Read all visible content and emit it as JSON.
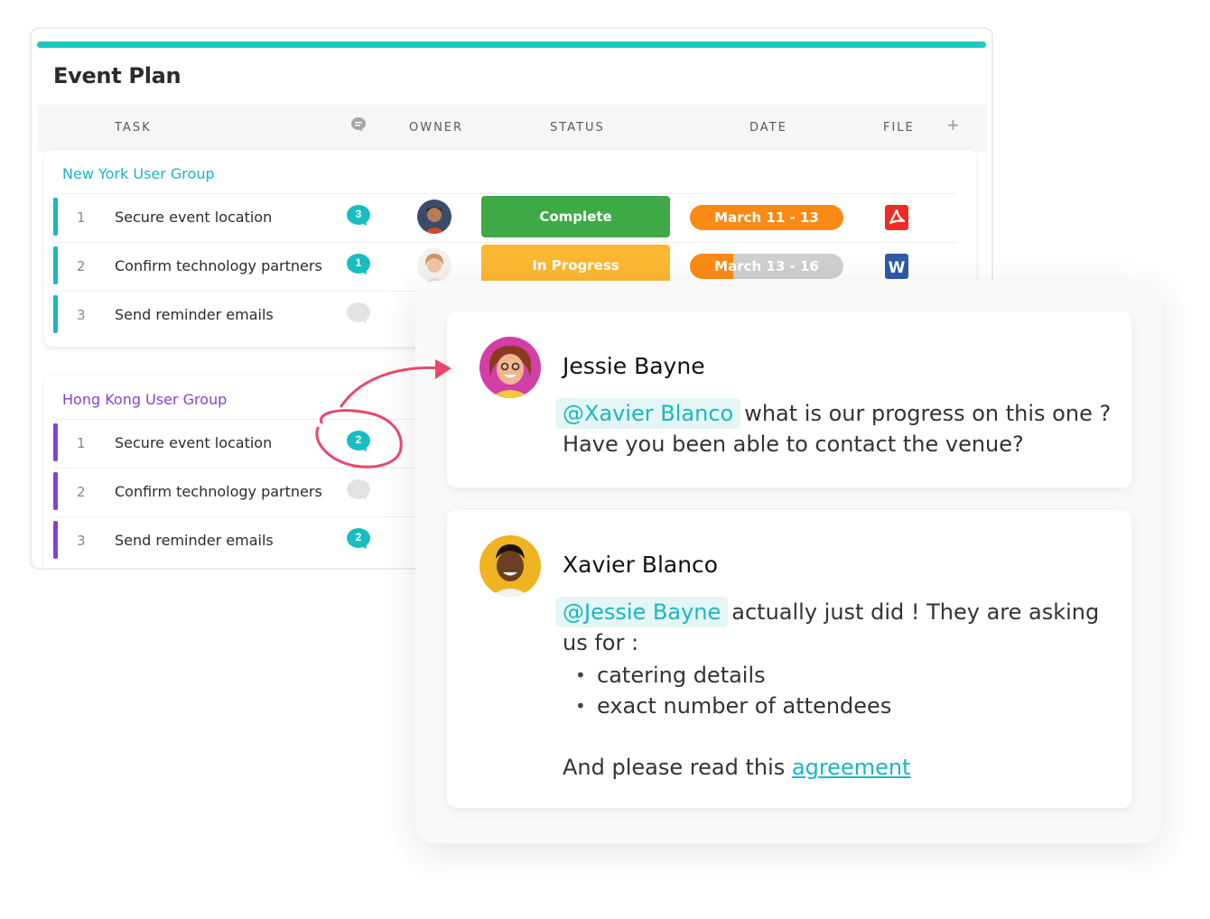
{
  "board": {
    "title": "Event Plan",
    "columns": {
      "task": "TASK",
      "owner": "OWNER",
      "status": "STATUS",
      "date": "DATE",
      "file": "FILE"
    },
    "add_column": "+"
  },
  "groups": [
    {
      "title": "New York User Group",
      "color": "#1bb6c1",
      "rows": [
        {
          "num": "1",
          "task": "Secure event location",
          "comments": "3",
          "status": "Complete",
          "status_color": "#3daa45",
          "date": "March 11 - 13",
          "date_progress": 1.0,
          "file": "pdf-icon"
        },
        {
          "num": "2",
          "task": "Confirm technology partners",
          "comments": "1",
          "status": "In Progress",
          "status_color": "#fcb733",
          "date": "March 13 - 16",
          "date_progress": 0.28,
          "file": "word-icon"
        },
        {
          "num": "3",
          "task": "Send reminder emails",
          "comments": "",
          "status": "",
          "date": "",
          "file": ""
        }
      ]
    },
    {
      "title": "Hong Kong User Group",
      "color": "#8a3fcf",
      "rows": [
        {
          "num": "1",
          "task": "Secure event location",
          "comments": "2"
        },
        {
          "num": "2",
          "task": "Confirm technology partners",
          "comments": ""
        },
        {
          "num": "3",
          "task": "Send reminder emails",
          "comments": "2"
        }
      ]
    }
  ],
  "conversation": {
    "messages": [
      {
        "author": "Jessie Bayne",
        "mention": "@Xavier Blanco",
        "text": "what is our progress on this one ? Have you been able to contact the venue?"
      },
      {
        "author": "Xavier Blanco",
        "mention": "@Jessie Bayne",
        "text": "actually just did ! They are asking us for :",
        "bullets": [
          "catering details",
          "exact number of attendees"
        ],
        "closing": "And please read this",
        "link": "agreement"
      }
    ]
  },
  "colors": {
    "accent": "#1ec8c0",
    "annotation": "#e8476a"
  }
}
